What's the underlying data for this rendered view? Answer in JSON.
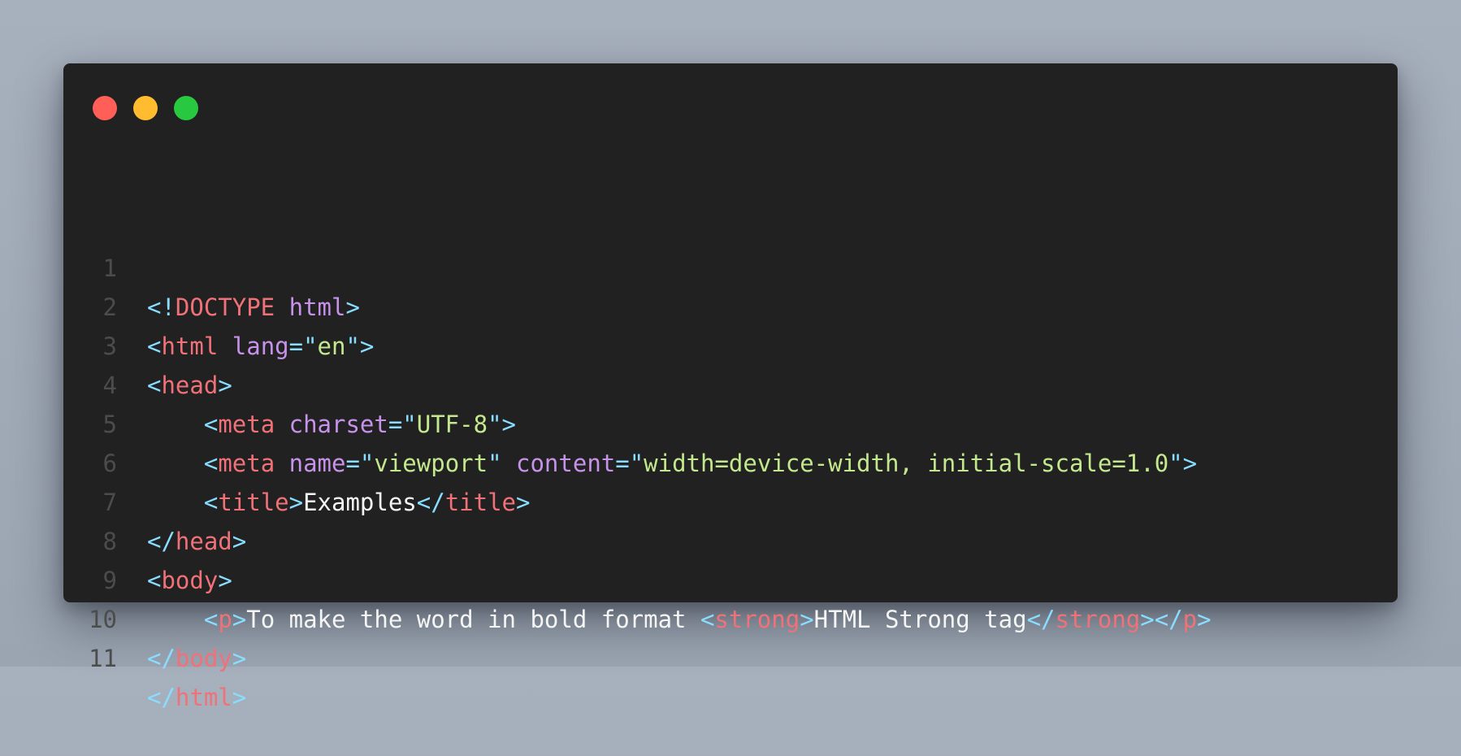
{
  "window": {
    "controls": [
      "close-dot",
      "minimize-dot",
      "maximize-dot"
    ],
    "colors": {
      "background": "#212121",
      "close": "#ff5f57",
      "minimize": "#febc2e",
      "maximize": "#28c840",
      "punctuation": "#89ddff",
      "tag": "#f07178",
      "attribute": "#c792ea",
      "string": "#c3e88d",
      "text": "#f5f5f5",
      "line_number": "#4c4c4c"
    }
  },
  "code": {
    "line_numbers": [
      "1",
      "2",
      "3",
      "4",
      "5",
      "6",
      "7",
      "8",
      "9",
      "10",
      "11"
    ],
    "lines": [
      [
        {
          "k": "p",
          "v": "<!"
        },
        {
          "k": "t",
          "v": "DOCTYPE"
        },
        {
          "k": "x",
          "v": " "
        },
        {
          "k": "a",
          "v": "html"
        },
        {
          "k": "p",
          "v": ">"
        }
      ],
      [
        {
          "k": "p",
          "v": "<"
        },
        {
          "k": "t",
          "v": "html"
        },
        {
          "k": "x",
          "v": " "
        },
        {
          "k": "a",
          "v": "lang"
        },
        {
          "k": "p",
          "v": "=\""
        },
        {
          "k": "s",
          "v": "en"
        },
        {
          "k": "p",
          "v": "\">"
        }
      ],
      [
        {
          "k": "p",
          "v": "<"
        },
        {
          "k": "t",
          "v": "head"
        },
        {
          "k": "p",
          "v": ">"
        }
      ],
      [
        {
          "k": "x",
          "v": "    "
        },
        {
          "k": "p",
          "v": "<"
        },
        {
          "k": "t",
          "v": "meta"
        },
        {
          "k": "x",
          "v": " "
        },
        {
          "k": "a",
          "v": "charset"
        },
        {
          "k": "p",
          "v": "=\""
        },
        {
          "k": "s",
          "v": "UTF-8"
        },
        {
          "k": "p",
          "v": "\">"
        }
      ],
      [
        {
          "k": "x",
          "v": "    "
        },
        {
          "k": "p",
          "v": "<"
        },
        {
          "k": "t",
          "v": "meta"
        },
        {
          "k": "x",
          "v": " "
        },
        {
          "k": "a",
          "v": "name"
        },
        {
          "k": "p",
          "v": "=\""
        },
        {
          "k": "s",
          "v": "viewport"
        },
        {
          "k": "p",
          "v": "\""
        },
        {
          "k": "x",
          "v": " "
        },
        {
          "k": "a",
          "v": "content"
        },
        {
          "k": "p",
          "v": "=\""
        },
        {
          "k": "s",
          "v": "width=device-width, initial-scale=1.0"
        },
        {
          "k": "p",
          "v": "\">"
        }
      ],
      [
        {
          "k": "x",
          "v": "    "
        },
        {
          "k": "p",
          "v": "<"
        },
        {
          "k": "t",
          "v": "title"
        },
        {
          "k": "p",
          "v": ">"
        },
        {
          "k": "x",
          "v": "Examples"
        },
        {
          "k": "p",
          "v": "</"
        },
        {
          "k": "t",
          "v": "title"
        },
        {
          "k": "p",
          "v": ">"
        }
      ],
      [
        {
          "k": "p",
          "v": "</"
        },
        {
          "k": "t",
          "v": "head"
        },
        {
          "k": "p",
          "v": ">"
        }
      ],
      [
        {
          "k": "p",
          "v": "<"
        },
        {
          "k": "t",
          "v": "body"
        },
        {
          "k": "p",
          "v": ">"
        }
      ],
      [
        {
          "k": "x",
          "v": "    "
        },
        {
          "k": "p",
          "v": "<"
        },
        {
          "k": "t",
          "v": "p"
        },
        {
          "k": "p",
          "v": ">"
        },
        {
          "k": "x",
          "v": "To make the word in bold format "
        },
        {
          "k": "p",
          "v": "<"
        },
        {
          "k": "t",
          "v": "strong"
        },
        {
          "k": "p",
          "v": ">"
        },
        {
          "k": "x",
          "v": "HTML Strong tag"
        },
        {
          "k": "p",
          "v": "</"
        },
        {
          "k": "t",
          "v": "strong"
        },
        {
          "k": "p",
          "v": "></"
        },
        {
          "k": "t",
          "v": "p"
        },
        {
          "k": "p",
          "v": ">"
        }
      ],
      [
        {
          "k": "p",
          "v": "</"
        },
        {
          "k": "t",
          "v": "body"
        },
        {
          "k": "p",
          "v": ">"
        }
      ],
      [
        {
          "k": "p",
          "v": "</"
        },
        {
          "k": "t",
          "v": "html"
        },
        {
          "k": "p",
          "v": ">"
        }
      ]
    ]
  }
}
